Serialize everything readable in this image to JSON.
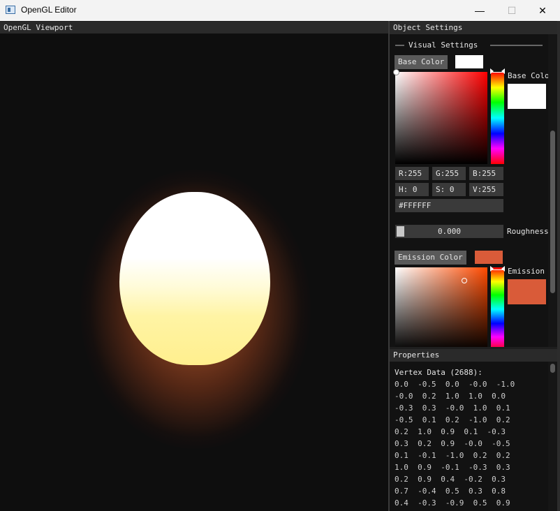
{
  "window": {
    "title": "OpenGL Editor",
    "buttons": {
      "minimize": "—",
      "maximize": "☐",
      "close": "✕"
    }
  },
  "viewport": {
    "title": "OpenGL Viewport",
    "colors": {
      "background": "#0e0e0e",
      "glow": "#e66e37",
      "sphere_top": "#ffffff",
      "sphere_bottom": "#ffef8e"
    }
  },
  "object_settings": {
    "title": "Object Settings",
    "section_title": "Visual Settings",
    "base_color": {
      "button_label": "Base Color",
      "picker_label": "Base Color",
      "r": "R:255",
      "g": "G:255",
      "b": "B:255",
      "h": "H:  0",
      "s": "S:  0",
      "v": "V:255",
      "hex": "#FFFFFF",
      "color": "#ffffff",
      "hue_color": "#ff0000"
    },
    "roughness": {
      "value": "0.000",
      "label": "Roughness",
      "fraction": 0.0
    },
    "emission_color": {
      "button_label": "Emission Color",
      "picker_label": "Emission Color",
      "color": "#d95b39",
      "hue_color": "#ff4a00"
    }
  },
  "properties": {
    "title": "Properties",
    "vertex_data_label": "Vertex Data (2688):",
    "rows": [
      "0.0  -0.5  0.0  -0.0  -1.0",
      "-0.0  0.2  1.0  1.0  0.0",
      "-0.3  0.3  -0.0  1.0  0.1",
      "-0.5  0.1  0.2  -1.0  0.2",
      "0.2  1.0  0.9  0.1  -0.3",
      "0.3  0.2  0.9  -0.0  -0.5",
      "0.1  -0.1  -1.0  0.2  0.2",
      "1.0  0.9  -0.1  -0.3  0.3",
      "0.2  0.9  0.4  -0.2  0.3",
      "0.7  -0.4  0.5  0.3  0.8",
      "0.4  -0.3  -0.9  0.5  0.9"
    ]
  }
}
